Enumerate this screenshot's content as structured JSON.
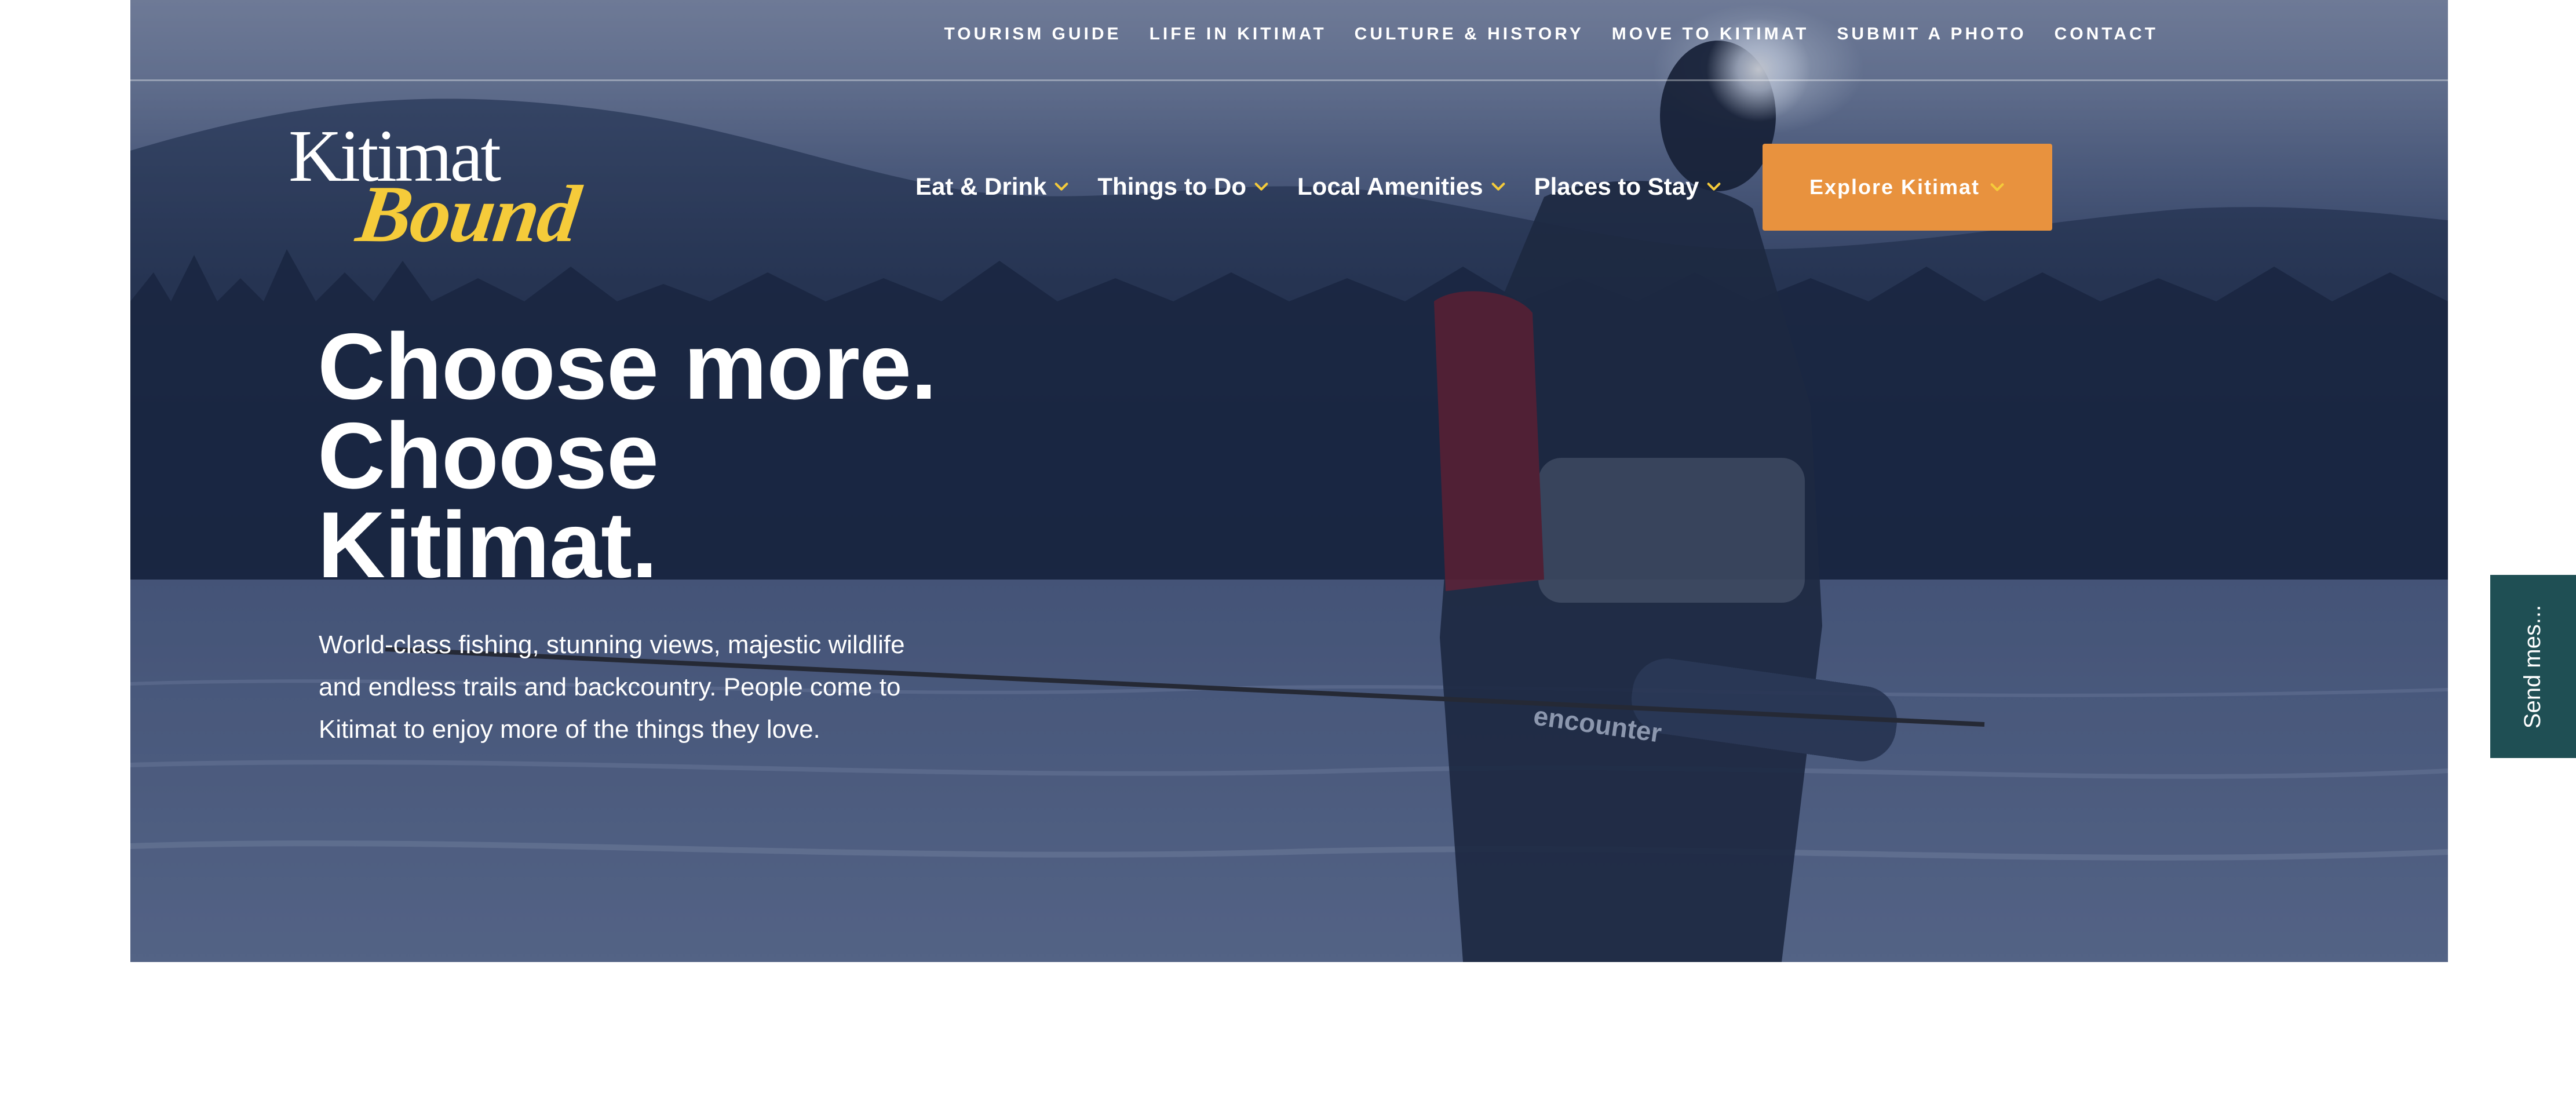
{
  "utility_nav": {
    "items": [
      {
        "label": "TOURISM GUIDE"
      },
      {
        "label": "LIFE IN KITIMAT"
      },
      {
        "label": "CULTURE & HISTORY"
      },
      {
        "label": "MOVE TO KITIMAT"
      },
      {
        "label": "SUBMIT A PHOTO"
      },
      {
        "label": "CONTACT"
      }
    ]
  },
  "logo": {
    "top_text": "Kitimat",
    "bottom_text": "Bound",
    "colors": {
      "top": "#ffffff",
      "bottom": "#f5cb3a"
    }
  },
  "main_nav": {
    "items": [
      {
        "label": "Eat & Drink",
        "icon": "chevron-down-icon"
      },
      {
        "label": "Things to Do",
        "icon": "chevron-down-icon"
      },
      {
        "label": "Local Amenities",
        "icon": "chevron-down-icon"
      },
      {
        "label": "Places to Stay",
        "icon": "chevron-down-icon"
      }
    ],
    "chevron_color": "#f5cb3a"
  },
  "explore_button": {
    "label": "Explore Kitimat",
    "icon": "chevron-down-icon",
    "color": "#e8923e"
  },
  "hero": {
    "headline_lines": [
      "Choose more.",
      "Choose",
      "Kitimat."
    ],
    "subtext_lines": [
      "World-class fishing, stunning views, majestic wildlife",
      "and endless trails and backcountry. People come to",
      "Kitimat to enjoy more of the things they love."
    ],
    "rod_case_text": "encounter"
  },
  "side_tab": {
    "label": "Send mes...",
    "color": "#1f4f54"
  }
}
